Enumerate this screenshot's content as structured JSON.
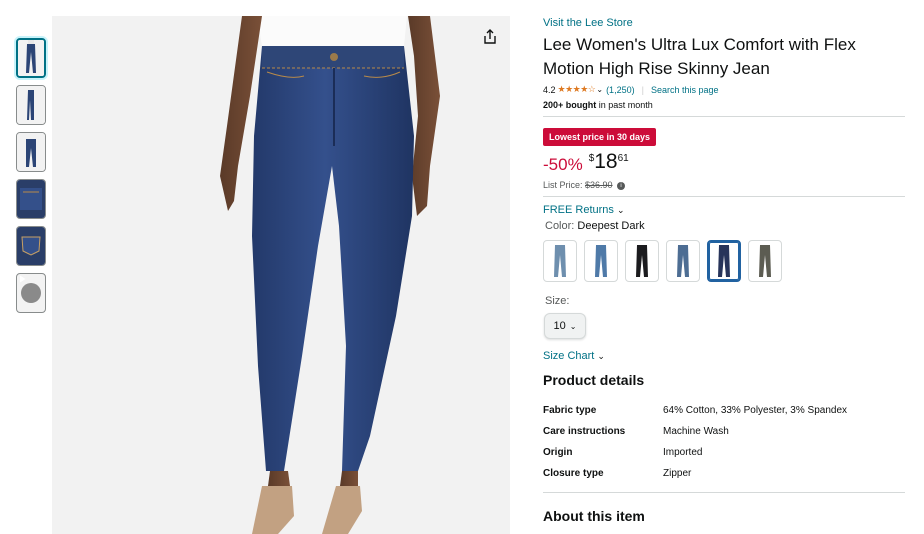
{
  "store_link": "Visit the Lee Store",
  "title": "Lee Women's Ultra Lux Comfort with Flex Motion High Rise Skinny Jean",
  "rating": {
    "value": "4.2",
    "stars": "★★★★☆",
    "count": "(1,250)",
    "search_link": "Search this page"
  },
  "bought": {
    "bold": "200+ bought",
    "rest": " in past month"
  },
  "deal_badge": "Lowest price in 30 days",
  "price": {
    "discount": "-50%",
    "currency": "$",
    "whole": "18",
    "fraction": "61",
    "list_label": "List Price: ",
    "list_value": "$36.90"
  },
  "returns": "FREE Returns",
  "color": {
    "label": "Color: ",
    "value": "Deepest Dark",
    "options": [
      "Light Wash",
      "Medium Wash",
      "Black",
      "Blue Grey",
      "Deepest Dark",
      "Olive"
    ],
    "swatch_colors": [
      "#6e8fae",
      "#4f7aa8",
      "#1b1b1e",
      "#4d6d93",
      "#27345a",
      "#5c5c52"
    ],
    "selected_index": 4
  },
  "size": {
    "label": "Size:",
    "value": "10"
  },
  "size_chart": "Size Chart",
  "product_details": {
    "heading": "Product details",
    "rows": [
      {
        "key": "Fabric type",
        "value": "64% Cotton, 33% Polyester, 3% Spandex"
      },
      {
        "key": "Care instructions",
        "value": "Machine Wash"
      },
      {
        "key": "Origin",
        "value": "Imported"
      },
      {
        "key": "Closure type",
        "value": "Zipper"
      }
    ]
  },
  "about_heading": "About this item",
  "icons": {
    "share": "share-icon",
    "play": "play-icon",
    "info": "info-icon",
    "chevron": "chevron-down-icon"
  },
  "colors": {
    "link": "#007185",
    "deal": "#cc0c39",
    "star": "#de7921",
    "selected_border": "#2162a1"
  }
}
